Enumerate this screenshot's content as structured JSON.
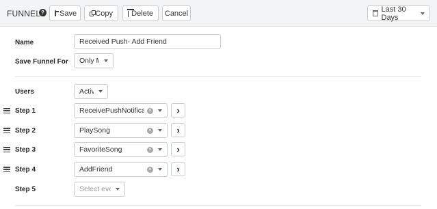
{
  "header": {
    "title": "FUNNELS",
    "help_icon": "?",
    "save_label": "Save",
    "copy_label": "Copy",
    "delete_label": "Delete",
    "cancel_label": "Cancel",
    "date_range": "Last 30 Days"
  },
  "form": {
    "name_label": "Name",
    "name_value": "Received Push- Add Friend",
    "save_for_label": "Save Funnel For",
    "save_for_value": "Only Me",
    "users_label": "Users",
    "users_value": "Active",
    "steps": [
      {
        "label": "Step 1",
        "event": "ReceivePushNotification"
      },
      {
        "label": "Step 2",
        "event": "PlaySong"
      },
      {
        "label": "Step 3",
        "event": "FavoriteSong"
      },
      {
        "label": "Step 4",
        "event": "AddFriend"
      }
    ],
    "step5_label": "Step 5",
    "step5_placeholder": "Select event"
  },
  "icons": {
    "clear": "×",
    "arrow": "›"
  }
}
